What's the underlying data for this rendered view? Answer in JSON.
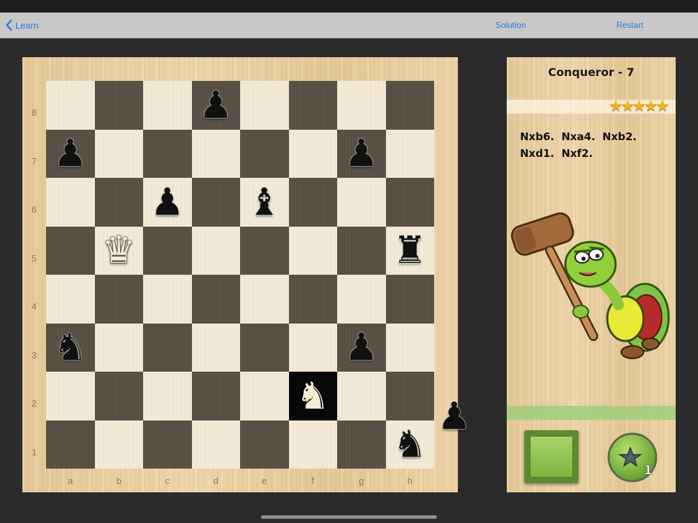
{
  "nav": {
    "back_label": "Learn",
    "solution_label": "Solution",
    "restart_label": "Restart"
  },
  "board": {
    "ranks": [
      "8",
      "7",
      "6",
      "5",
      "4",
      "3",
      "2",
      "1"
    ],
    "files": [
      "a",
      "b",
      "c",
      "d",
      "e",
      "f",
      "g",
      "h"
    ],
    "highlight": "f2",
    "pieces": [
      {
        "square": "d8",
        "type": "pawn",
        "color": "black",
        "glyph": "♟"
      },
      {
        "square": "a7",
        "type": "pawn",
        "color": "black",
        "glyph": "♟"
      },
      {
        "square": "g7",
        "type": "pawn",
        "color": "black",
        "glyph": "♟"
      },
      {
        "square": "c6",
        "type": "pawn",
        "color": "black",
        "glyph": "♟"
      },
      {
        "square": "e6",
        "type": "bishop",
        "color": "black",
        "glyph": "♝"
      },
      {
        "square": "b5",
        "type": "queen",
        "color": "white",
        "glyph": "♛"
      },
      {
        "square": "h5",
        "type": "rook",
        "color": "black",
        "glyph": "♜"
      },
      {
        "square": "a3",
        "type": "knight",
        "color": "black",
        "glyph": "♞"
      },
      {
        "square": "g3",
        "type": "pawn",
        "color": "black",
        "glyph": "♟"
      },
      {
        "square": "f2",
        "type": "knight",
        "color": "white",
        "glyph": "♞"
      },
      {
        "square": "h1",
        "type": "knight",
        "color": "black",
        "glyph": "♞"
      }
    ],
    "off_board": [
      {
        "type": "pawn",
        "color": "black",
        "glyph": "♟"
      }
    ]
  },
  "panel": {
    "title": "Conqueror - 7",
    "stars": "★★★★★",
    "moves": "Nxb6. Nxa4. Nxb2. Nxd1. Nxf2.",
    "hint_count": "1"
  },
  "colors": {
    "accent": "#1f7ae0",
    "light_square": "#f2ead7",
    "dark_square": "#5b5247",
    "star": "#f3b41d",
    "button_green": "#7fb23f"
  },
  "icons": {
    "back": "chevron-left-icon",
    "mascot": "turtle-hammer-mascot",
    "hint": "star-icon"
  }
}
